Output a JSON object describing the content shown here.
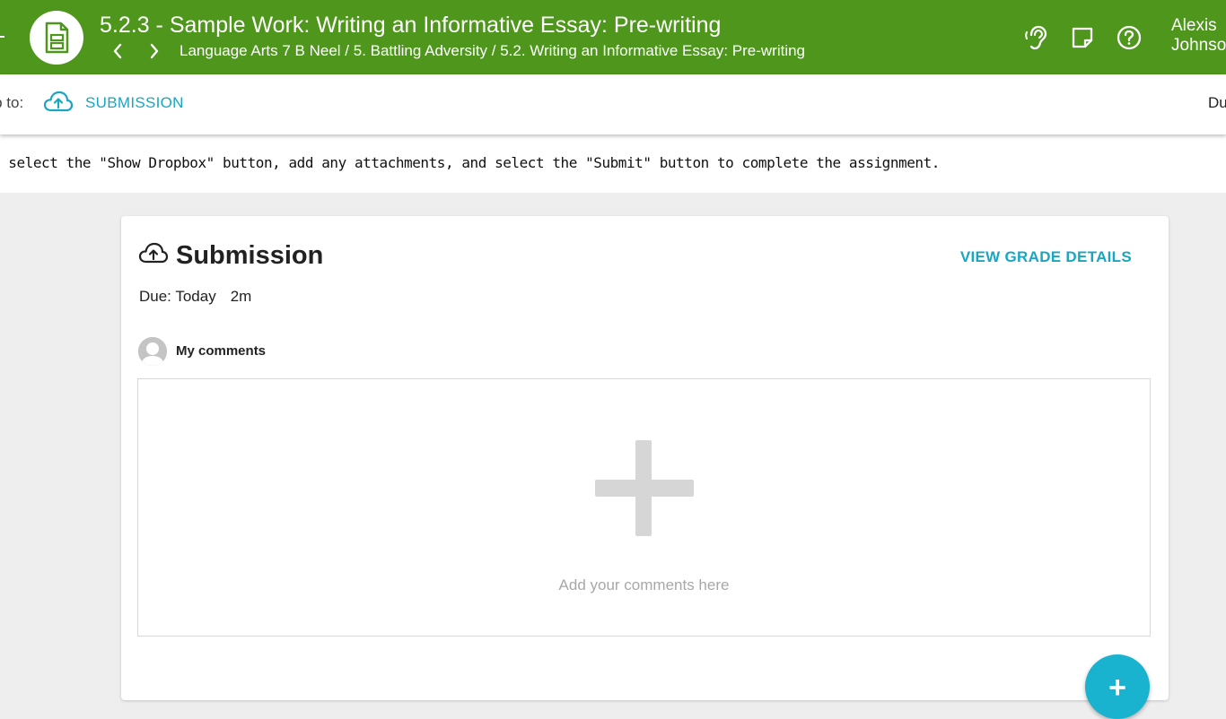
{
  "header": {
    "title": "5.2.3 - Sample Work: Writing an Informative Essay: Pre-writing",
    "breadcrumb": "Language Arts 7 B Neel / 5. Battling Adversity / 5.2. Writing an Informative Essay: Pre-writing",
    "user_name_line1": "Alexis",
    "user_name_line2": "Johnson",
    "icons": [
      "ear-icon",
      "sticky-note-icon",
      "help-icon"
    ]
  },
  "jump_bar": {
    "label": "Jump to:",
    "submission_link": "SUBMISSION",
    "due_label": "Due"
  },
  "instructions": {
    "text": "Please select the \"Show Dropbox\" button, add any attachments, and select the \"Submit\" button to complete the assignment."
  },
  "submission_card": {
    "title": "Submission",
    "grade_details_link": "VIEW GRADE DETAILS",
    "due_text": "Due: Today",
    "due_time": "2m",
    "comments_label": "My comments",
    "comment_placeholder": "Add your comments here"
  },
  "fab": {
    "label": "+"
  },
  "colors": {
    "header_green": "#4e961c",
    "accent_teal": "#19a6c2",
    "fab_teal": "#19b3d0"
  }
}
